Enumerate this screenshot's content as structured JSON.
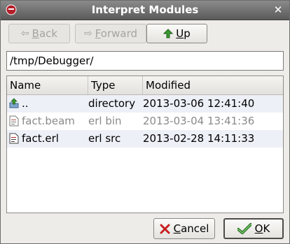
{
  "window": {
    "title": "Interpret Modules",
    "close_glyph": "✕"
  },
  "toolbar": {
    "back": {
      "mnemonic": "B",
      "rest": "ack",
      "icon": "left-arrow-icon",
      "enabled": false
    },
    "forward": {
      "mnemonic": "F",
      "rest": "orward",
      "icon": "right-arrow-icon",
      "enabled": false
    },
    "up": {
      "mnemonic": "U",
      "rest": "p",
      "icon": "up-arrow-icon",
      "enabled": true
    }
  },
  "path": {
    "value": "/tmp/Debugger/"
  },
  "list": {
    "columns": [
      "Name",
      "Type",
      "Modified"
    ],
    "rows": [
      {
        "name": "..",
        "type": "directory",
        "modified": "2013-03-06 12:41:40",
        "icon": "folder-up-icon",
        "dim": false
      },
      {
        "name": "fact.beam",
        "type": "erl bin",
        "modified": "2013-03-04 13:41:36",
        "icon": "file-icon",
        "dim": true
      },
      {
        "name": "fact.erl",
        "type": "erl src",
        "modified": "2013-02-28 14:11:33",
        "icon": "file-icon",
        "dim": false
      }
    ]
  },
  "buttons": {
    "cancel": {
      "mnemonic": "C",
      "rest": "ancel",
      "icon": "cancel-x-icon"
    },
    "ok": {
      "mnemonic": "O",
      "rest": "K",
      "icon": "check-icon"
    }
  },
  "colors": {
    "accent_green": "#2f8a2a",
    "cancel_red": "#c62020",
    "row_alt": "#eef0f8"
  }
}
